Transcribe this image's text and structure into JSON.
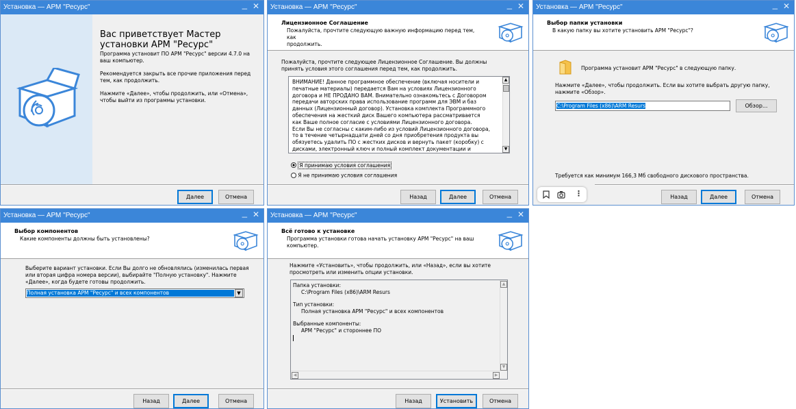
{
  "windows": {
    "welcome": {
      "title": "Установка — АРМ \"Ресурс\"",
      "heading_line1": "Вас приветствует Мастер",
      "heading_line2": "установки АРМ \"Ресурс\"",
      "p1_line1": "Программа установит ПО АРМ \"Ресурс\" версии 4.7.0 на",
      "p1_line2": "ваш компьютер.",
      "p2_line1": "Рекомендуется закрыть все прочие приложения перед",
      "p2_line2": "тем, как продолжить.",
      "p3_line1": "Нажмите «Далее», чтобы продолжить, или «Отмена»,",
      "p3_line2": "чтобы выйти из программы установки.",
      "next": "Далее",
      "cancel": "Отмена"
    },
    "license": {
      "title": "Установка — АРМ \"Ресурс\"",
      "header_title": "Лицензионное Соглашение",
      "header_sub_line1": "Пожалуйста, прочтите следующую важную информацию перед тем, как",
      "header_sub_line2": "продолжить.",
      "intro_line1": "Пожалуйста, прочтите следующее Лицензионное Соглашение. Вы должны",
      "intro_line2": "принять условия этого соглашения перед тем, как продолжить.",
      "license_lines": [
        "ВНИМАНИЕ! Данное программное обеспечение (включая носители и",
        "печатные материалы) передается Вам на условиях Лицензионного",
        "договора и НЕ ПРОДАНО ВАМ. Внимательно ознакомьтесь с Договором",
        "передачи авторских права использование программ для ЭВМ и баз",
        "данных (Лицензионный договор). Установка комплекта Программного",
        "обеспечения на жесткий диск Вашего компьютера рассматривается",
        "как Ваше полное согласие с условиями Лицензионного договора.",
        "Если Вы не согласны с каким-либо из условий Лицензионного договора,",
        "то в течение четырнадцати дней со дня приобретения продукта вы",
        "обязуетесь удалить ПО с жестких дисков и вернуть пакет (коробку) с",
        "дисками, электронный ключ и полный комплект документации и"
      ],
      "accept": "Я принимаю условия соглашения",
      "decline": "Я не принимаю условия соглашения",
      "back": "Назад",
      "next": "Далее",
      "cancel": "Отмена"
    },
    "folder": {
      "title": "Установка — АРМ \"Ресурс\"",
      "header_title": "Выбор папки установки",
      "header_sub": "В какую папку вы хотите установить АРМ \"Ресурс\"?",
      "folder_text": "Программа установит АРМ \"Ресурс\" в следующую папку.",
      "hint_line1": "Нажмите «Далее», чтобы продолжить. Если вы хотите выбрать другую папку,",
      "hint_line2": "нажмите «Обзор».",
      "path_value": "C:\\Program Files (x86)\\ARM Resurs",
      "browse": "Обзор...",
      "space": "Требуется как минимум 166,3 Мб свободного дискового пространства.",
      "back": "Назад",
      "next": "Далее",
      "cancel": "Отмена"
    },
    "components": {
      "title": "Установка — АРМ \"Ресурс\"",
      "header_title": "Выбор компонентов",
      "header_sub": "Какие компоненты должны быть установлены?",
      "desc_line1": "Выберите вариант установки. Если Вы долго не обновлялись (изменилась первая",
      "desc_line2": "или вторая цифра номера версии), выбирайте \"Полную установку\". Нажмите",
      "desc_line3": "«Далее», когда будете готовы продолжить.",
      "select_value": "Полная установка АРМ \"Ресурс\" и всех компонентов",
      "back": "Назад",
      "next": "Далее",
      "cancel": "Отмена"
    },
    "ready": {
      "title": "Установка — АРМ \"Ресурс\"",
      "header_title": "Всё готово к установке",
      "header_sub_line1": "Программа установки готова начать установку АРМ \"Ресурс\" на ваш",
      "header_sub_line2": "компьютер.",
      "desc_line1": "Нажмите «Установить», чтобы продолжить, или «Назад», если вы хотите",
      "desc_line2": "просмотреть или изменить опции установки.",
      "memo_folder_label": "Папка установки:",
      "memo_folder_value": "C:\\Program Files (x86)\\ARM Resurs",
      "memo_type_label": "Тип установки:",
      "memo_type_value": "Полная установка АРМ \"Ресурс\" и всех компонентов",
      "memo_comp_label": "Выбранные компоненты:",
      "memo_comp_value": "АРМ \"Ресурс\" и стороннее ПО",
      "back": "Назад",
      "install": "Установить",
      "cancel": "Отмена"
    }
  },
  "icons": {
    "setup_box": "setup-box-icon",
    "folder": "folder-icon",
    "bookmark": "bookmark-icon",
    "camera": "camera-icon",
    "more": "more-vertical-icon"
  },
  "colors": {
    "titlebar": "#3b86d9",
    "welcome_sidebar": "#dbe9f6",
    "selection": "#0078d7"
  }
}
